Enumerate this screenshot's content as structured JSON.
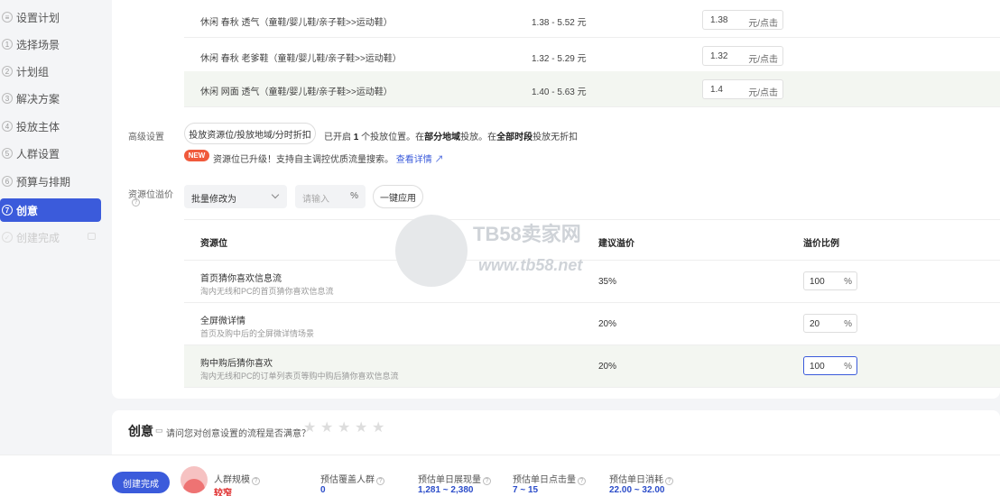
{
  "sidebar": {
    "items": [
      {
        "num": "",
        "label": "设置计划"
      },
      {
        "num": "1",
        "label": "选择场景"
      },
      {
        "num": "2",
        "label": "计划组"
      },
      {
        "num": "3",
        "label": "解决方案"
      },
      {
        "num": "4",
        "label": "投放主体"
      },
      {
        "num": "5",
        "label": "人群设置"
      },
      {
        "num": "6",
        "label": "预算与排期"
      },
      {
        "num": "7",
        "label": "创意"
      },
      {
        "num": "",
        "label": "创建完成"
      }
    ]
  },
  "price_rows": [
    {
      "name": "休闲 春秋 透气（童鞋/婴儿鞋/亲子鞋>>运动鞋）",
      "range": "1.38 - 5.52 元",
      "price": "1.38",
      "unit": "元/点击"
    },
    {
      "name": "休闲 春秋 老爹鞋（童鞋/婴儿鞋/亲子鞋>>运动鞋）",
      "range": "1.32 - 5.29 元",
      "price": "1.32",
      "unit": "元/点击"
    },
    {
      "name": "休闲 网面 透气（童鞋/婴儿鞋/亲子鞋>>运动鞋）",
      "range": "1.40 - 5.63 元",
      "price": "1.4",
      "unit": "元/点击"
    }
  ],
  "advanced": {
    "label": "高级设置",
    "button": "投放资源位/投放地域/分时折扣",
    "info_pre": "已开启",
    "info_count": "1",
    "info_mid1": "个投放位置。在",
    "info_region": "部分地域",
    "info_mid2": "投放。在",
    "info_time": "全部时段",
    "info_end": "投放无折扣"
  },
  "notice": {
    "badge": "NEW",
    "text": "资源位已升级！支持自主调控优质流量搜索。",
    "link": "查看详情"
  },
  "premium": {
    "label": "资源位溢价",
    "select": "批量修改为",
    "input_placeholder": "请输入",
    "unit": "%",
    "apply": "一键应用"
  },
  "table": {
    "headers": [
      "资源位",
      "建议溢价",
      "溢价比例"
    ],
    "rows": [
      {
        "title": "首页猜你喜欢信息流",
        "desc": "淘内无线和PC的首页猜你喜欢信息流",
        "suggest": "35%",
        "ratio": "100",
        "unit": "%"
      },
      {
        "title": "全屏微详情",
        "desc": "首页及购中后的全屏微详情场景",
        "suggest": "20%",
        "ratio": "20",
        "unit": "%"
      },
      {
        "title": "购中购后猜你喜欢",
        "desc": "淘内无线和PC的订单列表页等购中购后猜你喜欢信息流",
        "suggest": "20%",
        "ratio": "100",
        "unit": "%"
      }
    ]
  },
  "creative": {
    "title": "创意",
    "question": "请问您对创意设置的流程是否满意？"
  },
  "bottom": {
    "create_button": "创建完成",
    "crowd_label": "人群规模",
    "crowd_value": "较窄",
    "stats": [
      {
        "label": "预估覆盖人群",
        "value": "0"
      },
      {
        "label": "预估单日展现量",
        "value": "1,281 ~ 2,380"
      },
      {
        "label": "预估单日点击量",
        "value": "7 ~ 15"
      },
      {
        "label": "预估单日消耗",
        "value": "22.00 ~ 32.00"
      }
    ]
  },
  "watermark": {
    "text": "TB58卖家网",
    "url": "www.tb58.net"
  }
}
